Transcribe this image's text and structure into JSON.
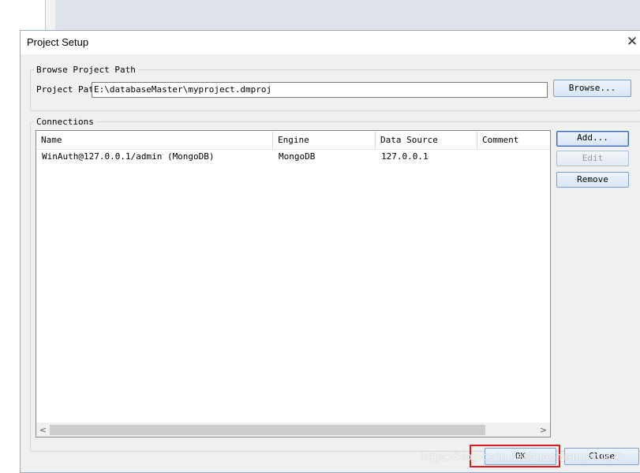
{
  "dialog": {
    "title": "Project Setup",
    "close_glyph": "✕"
  },
  "browse_group": {
    "legend": "Browse Project Path",
    "path_label": "Project Path",
    "path_value": "E:\\databaseMaster\\myproject.dmproj",
    "browse_label": "Browse..."
  },
  "connections_group": {
    "legend": "Connections",
    "columns": [
      "Name",
      "Engine",
      "Data Source",
      "Comment"
    ],
    "rows": [
      {
        "name": "WinAuth@127.0.0.1/admin (MongoDB)",
        "engine": "MongoDB",
        "data_source": "127.0.0.1",
        "comment": ""
      }
    ],
    "add_label": "Add...",
    "edit_label": "Edit",
    "remove_label": "Remove"
  },
  "footer": {
    "ok_label": "OK",
    "close_label": "Close"
  },
  "watermark": "https://blog.csdn.net/zhaomengszu123",
  "colors": {
    "highlight": "#e01a1a",
    "button_border": "#7aa0cf"
  }
}
